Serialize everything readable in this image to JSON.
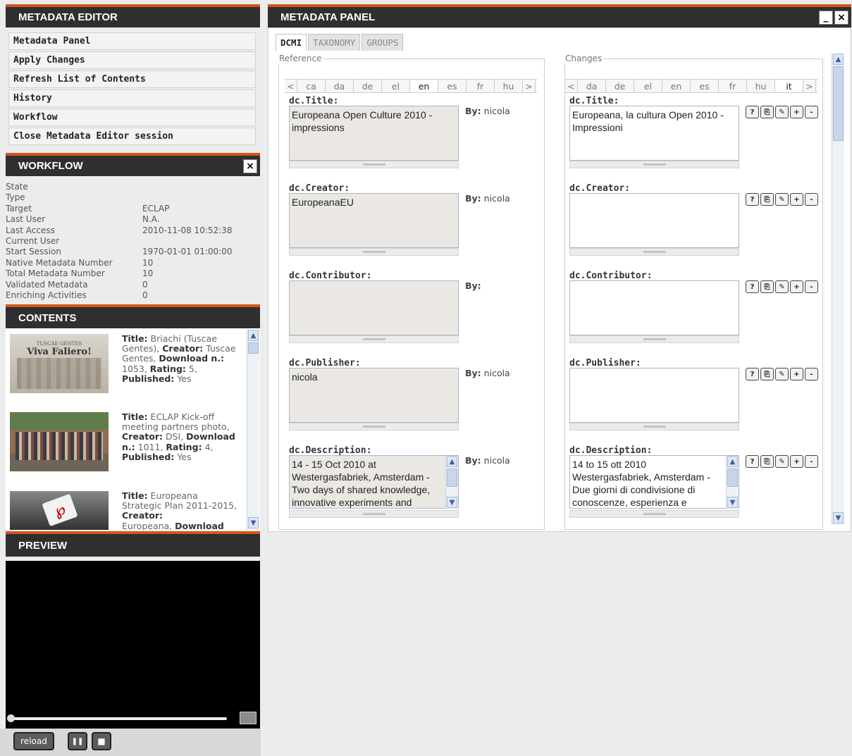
{
  "left": {
    "metadata_editor": {
      "title": "METADATA EDITOR",
      "menu": [
        "Metadata Panel",
        "Apply Changes",
        "Refresh List of Contents",
        "History",
        "Workflow",
        "Close Metadata Editor session"
      ]
    },
    "workflow": {
      "title": "WORKFLOW",
      "close_icon": "×",
      "rows": [
        {
          "k": "State",
          "v": ""
        },
        {
          "k": "Type",
          "v": ""
        },
        {
          "k": "Target",
          "v": "ECLAP"
        },
        {
          "k": "Last User",
          "v": "N.A."
        },
        {
          "k": "Last Access",
          "v": "2010-11-08 10:52:38"
        },
        {
          "k": "Current User",
          "v": ""
        },
        {
          "k": "Start Session",
          "v": "1970-01-01 01:00:00"
        },
        {
          "k": "Native Metadata Number",
          "v": "10"
        },
        {
          "k": "Total Metadata Number",
          "v": "10"
        },
        {
          "k": "Validated Metadata",
          "v": "0"
        },
        {
          "k": "Enriching Activities",
          "v": "0"
        }
      ]
    },
    "contents": {
      "title": "CONTENTS",
      "items": [
        {
          "thumb_text": "Viva Faliero!",
          "thumb_small": "TUSCAE GENTES",
          "title": "Briachi (Tuscae Gentes)",
          "creator": "Tuscae Gentes",
          "downloads": "1053",
          "rating": "5",
          "published": "Yes"
        },
        {
          "thumb_text": "",
          "thumb_small": "",
          "title": "ECLAP Kick-off meeting partners photo",
          "creator": "DSI",
          "downloads": "1011",
          "rating": "4",
          "published": "Yes"
        },
        {
          "thumb_text": "",
          "thumb_small": "",
          "title": "Europeana Strategic Plan 2011-2015",
          "creator": "Europeana",
          "downloads": "",
          "rating": "",
          "published": ""
        }
      ],
      "labels": {
        "title": "Title:",
        "creator": "Creator:",
        "download": "Download n.:",
        "rating": "Rating:",
        "published": "Published:",
        "download_cut": "Download"
      }
    },
    "preview": {
      "title": "PREVIEW",
      "reload": "reload",
      "pause_icon": "❚❚",
      "stop_icon": "■"
    }
  },
  "panel": {
    "title": "METADATA PANEL",
    "min_icon": "_",
    "close_icon": "×",
    "tabs": [
      "DCMI",
      "TAXONOMY",
      "GROUPS"
    ],
    "reference": {
      "legend": "Reference",
      "langs": [
        "<",
        "ca",
        "da",
        "de",
        "el",
        "en",
        "es",
        "fr",
        "hu",
        ">"
      ],
      "active_lang": "en"
    },
    "changes": {
      "legend": "Changes",
      "langs": [
        "<",
        "da",
        "de",
        "el",
        "en",
        "es",
        "fr",
        "hu",
        "it",
        ">"
      ],
      "active_lang": "it"
    },
    "by_label": "By:",
    "fields": [
      {
        "label": "dc.Title:",
        "ref": "Europeana Open Culture 2010 - impressions",
        "by": "nicola",
        "chg": "Europeana, la cultura Open 2010 - Impressioni"
      },
      {
        "label": "dc.Creator:",
        "ref": "EuropeanaEU",
        "by": "nicola",
        "chg": ""
      },
      {
        "label": "dc.Contributor:",
        "ref": "",
        "by": "",
        "chg": ""
      },
      {
        "label": "dc.Publisher:",
        "ref": "nicola",
        "by": "nicola",
        "chg": ""
      },
      {
        "label": "dc.Description:",
        "ref": "14 - 15 Oct 2010 at Westergasfabriek, Amsterdam - Two days of shared knowledge, innovative experiments and",
        "by": "nicola",
        "chg": "14 to 15 ott 2010 Westergasfabriek, Amsterdam - Due giorni di condivisione di conoscenze, esperienza e"
      }
    ],
    "action_icons": [
      "?",
      "⎘",
      "✎",
      "+",
      "-"
    ]
  }
}
